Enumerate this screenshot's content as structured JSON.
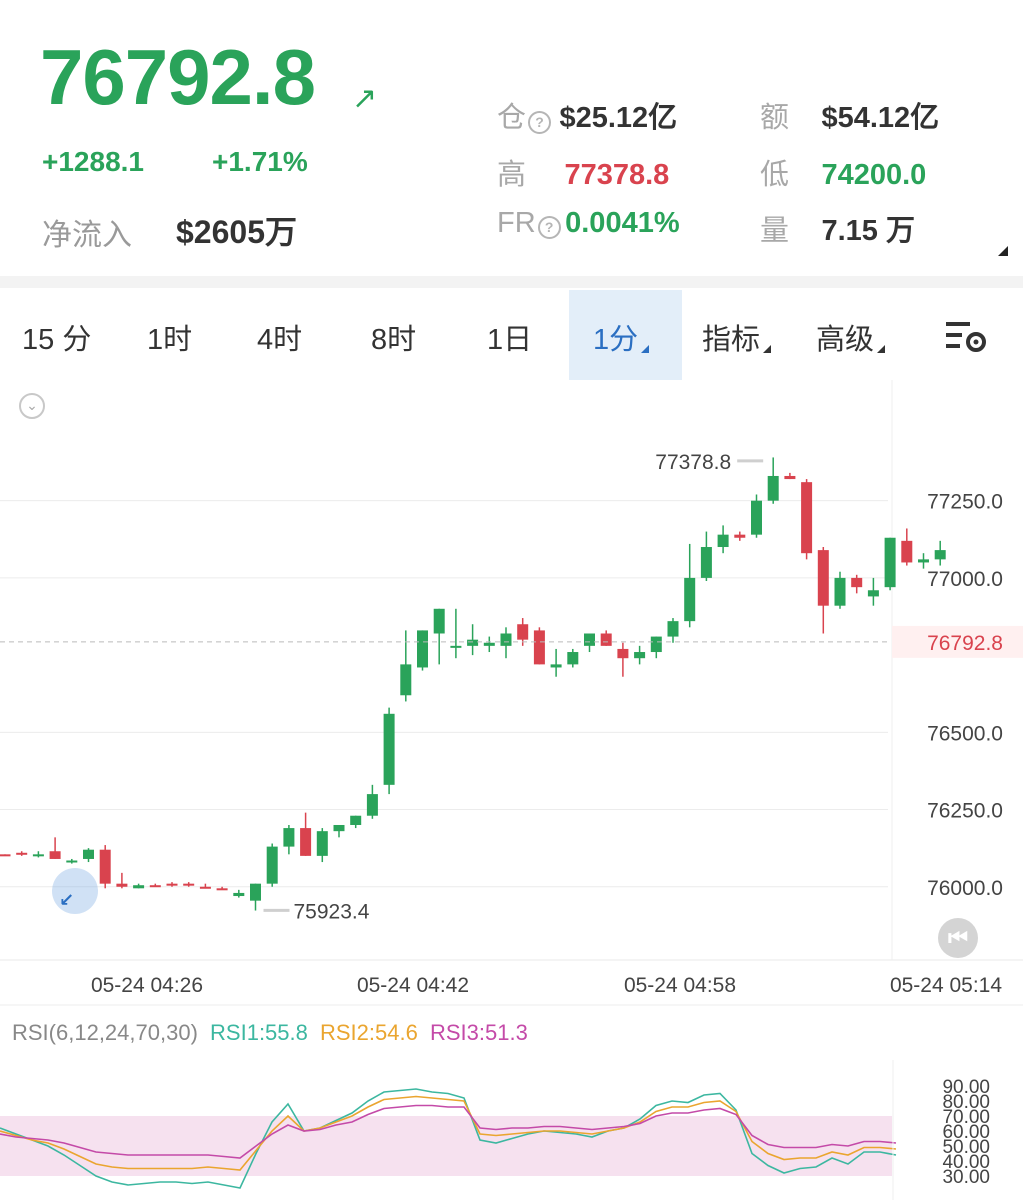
{
  "header": {
    "price": "76792.8",
    "change": "+1288.1",
    "change_pct": "+1.71%",
    "net_inflow_label": "净流入",
    "net_inflow_value": "$2605万",
    "colors": {
      "up": "#2aa35a",
      "down": "#d9434e"
    }
  },
  "stats": [
    {
      "label": "仓",
      "help": true,
      "value": "$25.12亿",
      "color": "#333333"
    },
    {
      "label": "额",
      "help": false,
      "value": "$54.12亿",
      "color": "#333333"
    },
    {
      "label": "高",
      "help": false,
      "value": "77378.8",
      "color": "#d9434e"
    },
    {
      "label": "低",
      "help": false,
      "value": "74200.0",
      "color": "#2aa35a"
    },
    {
      "label": "FR",
      "help": true,
      "value": "0.0041%",
      "color": "#2aa35a"
    },
    {
      "label": "量",
      "help": false,
      "value": "7.15 万",
      "color": "#333333"
    }
  ],
  "tabs": [
    {
      "label": "15 分"
    },
    {
      "label": "1时"
    },
    {
      "label": "4时"
    },
    {
      "label": "8时"
    },
    {
      "label": "1日"
    },
    {
      "label": "1分",
      "active": true,
      "dropdown": true
    },
    {
      "label": "指标",
      "dropdown": true
    },
    {
      "label": "高级",
      "dropdown": true
    }
  ],
  "chart_data": {
    "type": "candlestick",
    "ylim": [
      75860,
      77440
    ],
    "y_ticks": [
      "77250.0",
      "77000.0",
      "76500.0",
      "76250.0",
      "76000.0"
    ],
    "y_tick_values": [
      77250,
      77000,
      76500,
      76250,
      76000
    ],
    "x_ticks": [
      "05-24 04:26",
      "05-24 04:42",
      "05-24 04:58",
      "05-24 05:14"
    ],
    "last_price_label": "76792.8",
    "last_price": 76792.8,
    "high_label": "77378.8",
    "low_label": "75923.4",
    "candles": [
      [
        76105,
        76105,
        76100,
        76100
      ],
      [
        76110,
        76115,
        76100,
        76105
      ],
      [
        76100,
        76115,
        76095,
        76105
      ],
      [
        76115,
        76160,
        76090,
        76090
      ],
      [
        76085,
        76090,
        76075,
        76085
      ],
      [
        76090,
        76125,
        76080,
        76120
      ],
      [
        76120,
        76135,
        75995,
        76010
      ],
      [
        76010,
        76045,
        75995,
        76000
      ],
      [
        75995,
        76010,
        75995,
        76005
      ],
      [
        76005,
        76010,
        76000,
        76000
      ],
      [
        76010,
        76015,
        76000,
        76005
      ],
      [
        76010,
        76015,
        76000,
        76005
      ],
      [
        76000,
        76010,
        75995,
        75995
      ],
      [
        75995,
        76000,
        75990,
        75990
      ],
      [
        75970,
        75990,
        75965,
        75980
      ],
      [
        75955,
        76010,
        75923,
        76010
      ],
      [
        76010,
        76140,
        76000,
        76130
      ],
      [
        76130,
        76200,
        76105,
        76190
      ],
      [
        76190,
        76240,
        76100,
        76100
      ],
      [
        76100,
        76190,
        76080,
        76180
      ],
      [
        76180,
        76200,
        76160,
        76200
      ],
      [
        76200,
        76230,
        76190,
        76230
      ],
      [
        76230,
        76330,
        76220,
        76300
      ],
      [
        76330,
        76580,
        76300,
        76560
      ],
      [
        76620,
        76830,
        76600,
        76720
      ],
      [
        76710,
        76830,
        76700,
        76830
      ],
      [
        76820,
        76900,
        76720,
        76900
      ],
      [
        76780,
        76900,
        76740,
        76780
      ],
      [
        76780,
        76850,
        76750,
        76800
      ],
      [
        76780,
        76810,
        76760,
        76790
      ],
      [
        76780,
        76840,
        76740,
        76820
      ],
      [
        76850,
        76870,
        76780,
        76800
      ],
      [
        76830,
        76840,
        76720,
        76720
      ],
      [
        76710,
        76770,
        76680,
        76720
      ],
      [
        76720,
        76770,
        76710,
        76760
      ],
      [
        76780,
        76820,
        76760,
        76820
      ],
      [
        76820,
        76830,
        76780,
        76780
      ],
      [
        76770,
        76790,
        76680,
        76740
      ],
      [
        76740,
        76780,
        76720,
        76760
      ],
      [
        76760,
        76810,
        76740,
        76810
      ],
      [
        76810,
        76870,
        76790,
        76860
      ],
      [
        76860,
        77110,
        76840,
        77000
      ],
      [
        77000,
        77150,
        76990,
        77100
      ],
      [
        77100,
        77170,
        77080,
        77140
      ],
      [
        77140,
        77150,
        77120,
        77130
      ],
      [
        77140,
        77270,
        77130,
        77250
      ],
      [
        77250,
        77390,
        77240,
        77330
      ],
      [
        77330,
        77340,
        77320,
        77320
      ],
      [
        77310,
        77320,
        77060,
        77080
      ],
      [
        77090,
        77100,
        76820,
        76910
      ],
      [
        76910,
        77020,
        76900,
        77000
      ],
      [
        77000,
        77010,
        76950,
        76970
      ],
      [
        76940,
        77000,
        76910,
        76960
      ],
      [
        76970,
        77130,
        76960,
        77130
      ],
      [
        77120,
        77160,
        77040,
        77050
      ],
      [
        77050,
        77080,
        77030,
        77060
      ],
      [
        77060,
        77120,
        77040,
        77090
      ]
    ]
  },
  "rsi": {
    "legend": "RSI(6,12,24,70,30)",
    "rsi1_label": "RSI1:55.8",
    "rsi2_label": "RSI2:54.6",
    "rsi3_label": "RSI3:51.3",
    "colors": {
      "rsi1": "#3cb7a0",
      "rsi2": "#eaa52f",
      "rsi3": "#c44aa8",
      "band": "#f6e1ef"
    },
    "y_ticks": [
      "90.00",
      "80.00",
      "70.00",
      "60.00",
      "50.00",
      "40.00",
      "30.00"
    ],
    "y_tick_values": [
      90,
      80,
      70,
      60,
      50,
      40,
      30
    ],
    "band": [
      30,
      70
    ],
    "rsi1": [
      62,
      58,
      54,
      50,
      44,
      37,
      30,
      26,
      24,
      25,
      26,
      26,
      25,
      26,
      24,
      22,
      45,
      66,
      78,
      60,
      62,
      67,
      72,
      80,
      86,
      87,
      88,
      86,
      85,
      82,
      54,
      52,
      55,
      58,
      60,
      59,
      58,
      56,
      60,
      62,
      68,
      77,
      80,
      79,
      84,
      85,
      74,
      45,
      37,
      32,
      35,
      36,
      42,
      38,
      46,
      46,
      44
    ],
    "rsi2": [
      60,
      57,
      54,
      52,
      48,
      43,
      38,
      36,
      35,
      35,
      35,
      35,
      35,
      36,
      35,
      34,
      47,
      60,
      70,
      60,
      62,
      66,
      70,
      76,
      81,
      82,
      83,
      82,
      81,
      80,
      58,
      57,
      58,
      59,
      60,
      60,
      59,
      58,
      60,
      62,
      66,
      73,
      76,
      76,
      79,
      80,
      73,
      53,
      45,
      41,
      42,
      42,
      46,
      44,
      49,
      49,
      48
    ],
    "rsi3": [
      58,
      56,
      55,
      54,
      52,
      49,
      46,
      45,
      44,
      44,
      44,
      44,
      44,
      44,
      43,
      42,
      50,
      58,
      64,
      60,
      61,
      64,
      66,
      71,
      75,
      76,
      77,
      77,
      76,
      76,
      62,
      61,
      62,
      62,
      63,
      63,
      62,
      61,
      62,
      63,
      65,
      70,
      72,
      72,
      74,
      75,
      71,
      57,
      51,
      49,
      49,
      49,
      51,
      50,
      53,
      53,
      52
    ]
  }
}
